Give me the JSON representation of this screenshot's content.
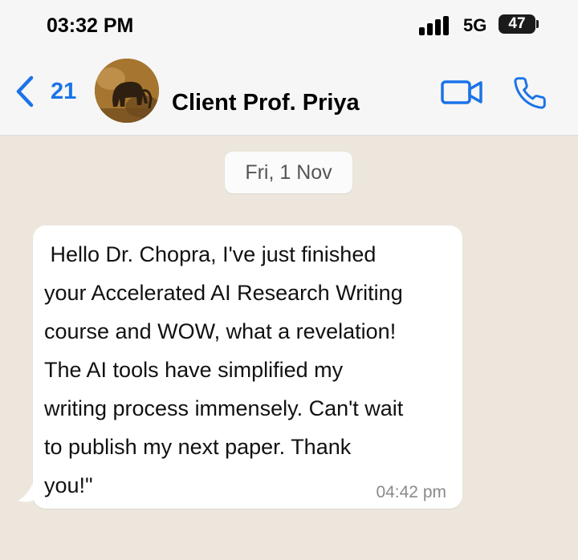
{
  "status_bar": {
    "time": "03:32 PM",
    "network": "5G",
    "battery": "47",
    "signal_icon": "signal-bars-icon"
  },
  "header": {
    "back_count": "21",
    "contact_name": "Client Prof. Priya",
    "back_icon": "chevron-left-icon",
    "video_icon": "video-camera-icon",
    "call_icon": "phone-icon",
    "accent_color": "#1a73e8"
  },
  "chat": {
    "date_label": "Fri, 1 Nov",
    "message": {
      "text": " Hello Dr. Chopra, I've just finished\nyour Accelerated AI Research Writing\ncourse and WOW, what a revelation!\nThe AI tools have simplified my\nwriting process immensely. Can't wait\nto publish my next paper. Thank\nyou!\"",
      "time": "04:42 pm"
    }
  }
}
